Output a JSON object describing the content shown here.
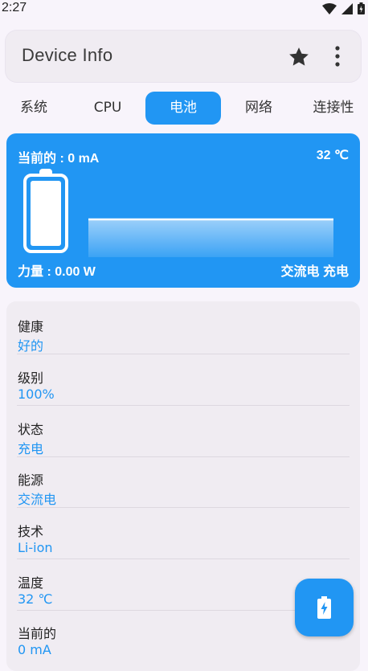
{
  "status_bar": {
    "time": "2:27"
  },
  "app_bar": {
    "title": "Device Info"
  },
  "tabs": [
    {
      "label": "系统"
    },
    {
      "label": "CPU"
    },
    {
      "label": "电池"
    },
    {
      "label": "网络"
    },
    {
      "label": "连接性"
    }
  ],
  "active_tab": "电池",
  "battery_card": {
    "current": "当前的 : 0 mA",
    "temperature": "32 ℃",
    "power": "力量 : 0.00 W",
    "source_status": "交流电 充电"
  },
  "info_rows": [
    {
      "label": "健康",
      "value": "好的"
    },
    {
      "label": "级别",
      "value": "100%"
    },
    {
      "label": "状态",
      "value": "充电"
    },
    {
      "label": "能源",
      "value": "交流电"
    },
    {
      "label": "技术",
      "value": "Li-ion"
    },
    {
      "label": "温度",
      "value": "32 ℃"
    },
    {
      "label": "当前的",
      "value": "0 mA"
    }
  ],
  "colors": {
    "accent": "#2196f3",
    "background": "#f8f4fb",
    "card": "#f0ecf2"
  },
  "icons": {
    "star": "star-icon",
    "more": "more-vert-icon",
    "fab": "battery-charging-icon"
  }
}
